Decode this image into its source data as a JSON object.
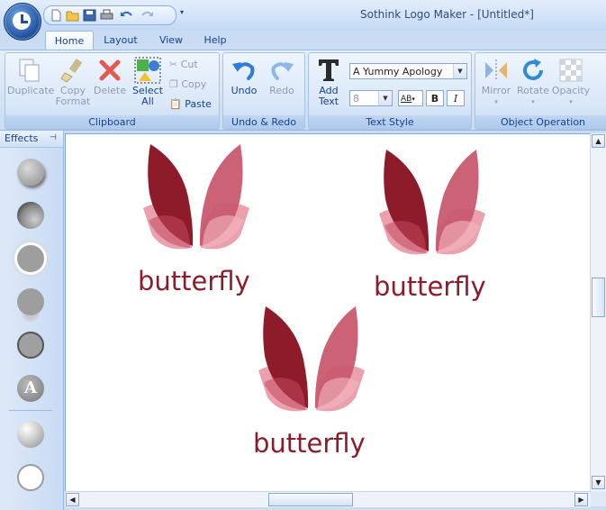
{
  "window": {
    "title": "Sothink Logo Maker - [Untitled*]"
  },
  "tabs": [
    {
      "label": "Home"
    },
    {
      "label": "Layout"
    },
    {
      "label": "View"
    },
    {
      "label": "Help"
    }
  ],
  "ribbon": {
    "clipboard": {
      "label": "Clipboard",
      "duplicate": "Duplicate",
      "copy_format": [
        "Copy",
        "Format"
      ],
      "delete": "Delete",
      "select_all": [
        "Select",
        "All"
      ],
      "cut": "Cut",
      "copy": "Copy",
      "paste": "Paste"
    },
    "undo_redo": {
      "label": "Undo & Redo",
      "undo": "Undo",
      "redo": "Redo"
    },
    "text_style": {
      "label": "Text Style",
      "add_text": [
        "Add",
        "Text"
      ],
      "font_name": "A Yummy Apology",
      "font_size": "8",
      "spacing_label": "AB",
      "bold": "B",
      "italic": "I"
    },
    "object_operation": {
      "label": "Object Operation",
      "mirror": "Mirror",
      "rotate": "Rotate",
      "opacity": "Opacity"
    }
  },
  "effects_panel": {
    "title": "Effects",
    "text_effect_letter": "A"
  },
  "canvas": {
    "logos": [
      {
        "word": "butterfly"
      },
      {
        "word": "butterfly"
      },
      {
        "word": "butterfly"
      }
    ]
  },
  "colors": {
    "wing_dark": "#8e1b2a",
    "wing_light": "#c85a6e",
    "wing_pink": "#eba0ad",
    "text": "#8a1d2b",
    "ribbon_label": "#15428b"
  }
}
